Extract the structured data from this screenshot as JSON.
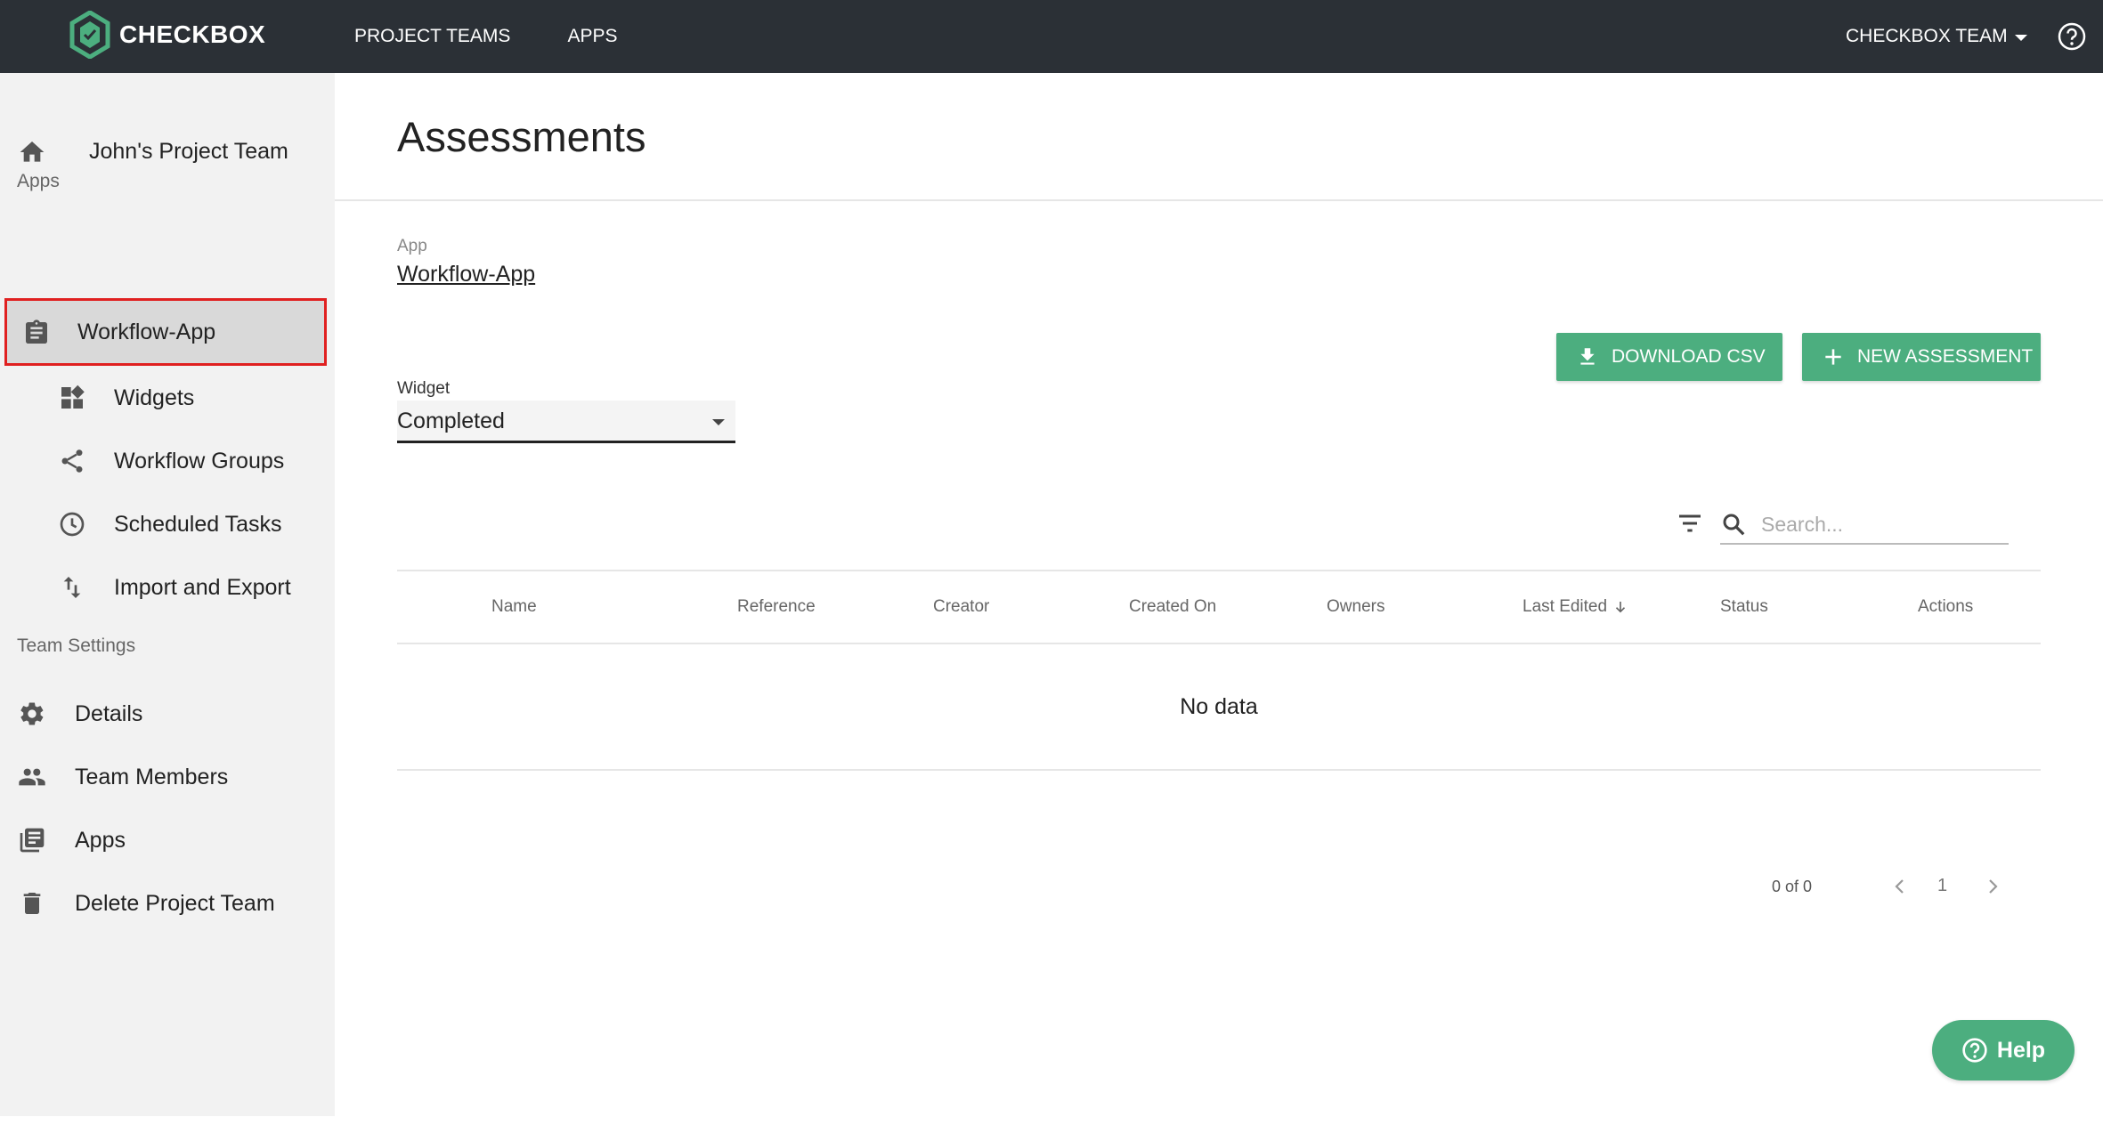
{
  "topbar": {
    "brand": "CHECKBOX",
    "nav": [
      "PROJECT TEAMS",
      "APPS"
    ],
    "team_switch": "CHECKBOX TEAM"
  },
  "sidebar": {
    "home_label": "John's Project Team",
    "apps_section": "Apps",
    "active_app": "Workflow-App",
    "app_items": [
      {
        "label": "Widgets",
        "icon": "widgets-icon"
      },
      {
        "label": "Workflow Groups",
        "icon": "share-icon"
      },
      {
        "label": "Scheduled Tasks",
        "icon": "clock-icon"
      },
      {
        "label": "Import and Export",
        "icon": "import-export-icon"
      }
    ],
    "team_section": "Team Settings",
    "team_items": [
      {
        "label": "Details",
        "icon": "gear-icon"
      },
      {
        "label": "Team Members",
        "icon": "people-icon"
      },
      {
        "label": "Apps",
        "icon": "library-icon"
      },
      {
        "label": "Delete Project Team",
        "icon": "trash-icon"
      }
    ]
  },
  "main": {
    "title": "Assessments",
    "app_caption": "App",
    "app_value": "Workflow-App",
    "widget_caption": "Widget",
    "widget_value": "Completed",
    "download_label": "DOWNLOAD CSV",
    "new_label": "NEW ASSESSMENT",
    "search_placeholder": "Search...",
    "columns": [
      "Name",
      "Reference",
      "Creator",
      "Created On",
      "Owners",
      "Last Edited",
      "Status",
      "Actions"
    ],
    "empty_text": "No data",
    "pager": {
      "count": "0 of 0",
      "page": "1"
    }
  },
  "help_fab": "Help",
  "colors": {
    "topbar": "#2b3036",
    "accent_green": "#4cae7f",
    "sidebar_bg": "#f2f2f2",
    "highlight_border": "#e02020"
  }
}
